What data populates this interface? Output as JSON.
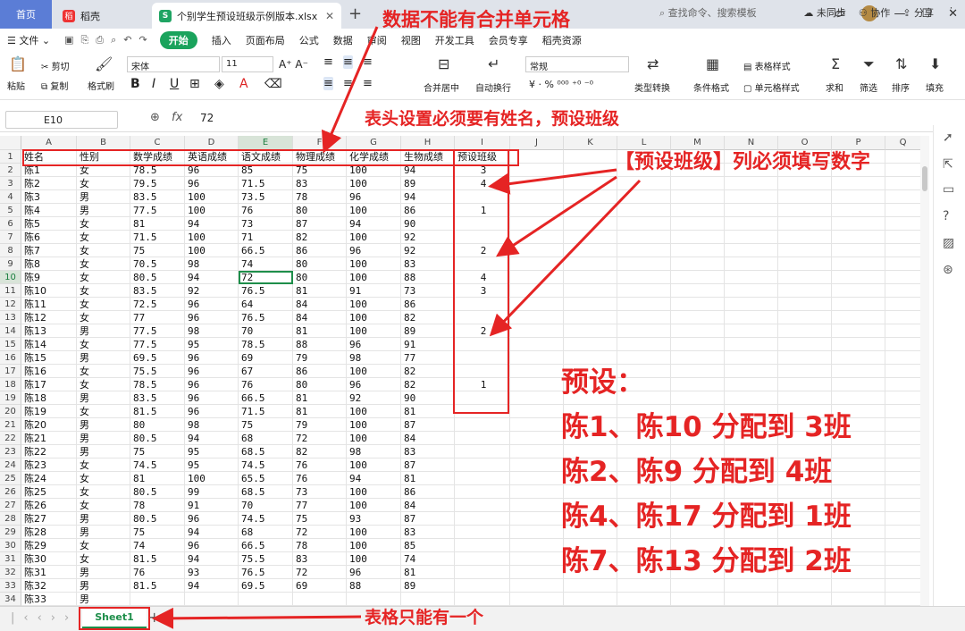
{
  "tabs": {
    "home": "首页",
    "docer": "稻壳",
    "file": "个别学生预设班级示例版本.xlsx"
  },
  "menu": {
    "file": "文件",
    "start": "开始",
    "items": [
      "插入",
      "页面布局",
      "公式",
      "数据",
      "审阅",
      "视图",
      "开发工具",
      "会员专享",
      "稻壳资源"
    ],
    "search": "查找命令、搜索模板",
    "right": [
      "未同步",
      "协作",
      "分享"
    ]
  },
  "ribbon": {
    "paste": "粘贴",
    "cut": "剪切",
    "copy": "复制",
    "format_painter": "格式刷",
    "font": "宋体",
    "size": "11",
    "num_format": "常规",
    "merge": "合并居中",
    "wrap": "自动换行",
    "convert": "类型转换",
    "cond_format": "条件格式",
    "table_style": "表格样式",
    "cell_style": "单元格样式",
    "sum": "求和",
    "filter": "筛选",
    "sort": "排序",
    "fill": "填充"
  },
  "formula_bar": {
    "cell_ref": "E10",
    "fx": "fx",
    "value": "72"
  },
  "columns": [
    "A",
    "B",
    "C",
    "D",
    "E",
    "F",
    "G",
    "H",
    "I",
    "J",
    "K",
    "L",
    "M",
    "N",
    "O",
    "P",
    "Q"
  ],
  "headers": [
    "姓名",
    "性别",
    "数学成绩",
    "英语成绩",
    "语文成绩",
    "物理成绩",
    "化学成绩",
    "生物成绩",
    "预设班级"
  ],
  "rows": [
    [
      "陈1",
      "女",
      "78.5",
      "96",
      "85",
      "75",
      "100",
      "94",
      "3"
    ],
    [
      "陈2",
      "女",
      "79.5",
      "96",
      "71.5",
      "83",
      "100",
      "89",
      "4"
    ],
    [
      "陈3",
      "男",
      "83.5",
      "100",
      "73.5",
      "78",
      "96",
      "94",
      ""
    ],
    [
      "陈4",
      "男",
      "77.5",
      "100",
      "76",
      "80",
      "100",
      "86",
      "1"
    ],
    [
      "陈5",
      "女",
      "81",
      "94",
      "73",
      "87",
      "94",
      "90",
      ""
    ],
    [
      "陈6",
      "女",
      "71.5",
      "100",
      "71",
      "82",
      "100",
      "92",
      ""
    ],
    [
      "陈7",
      "女",
      "75",
      "100",
      "66.5",
      "86",
      "96",
      "92",
      "2"
    ],
    [
      "陈8",
      "女",
      "70.5",
      "98",
      "74",
      "80",
      "100",
      "83",
      ""
    ],
    [
      "陈9",
      "女",
      "80.5",
      "94",
      "72",
      "80",
      "100",
      "88",
      "4"
    ],
    [
      "陈10",
      "女",
      "83.5",
      "92",
      "76.5",
      "81",
      "91",
      "73",
      "3"
    ],
    [
      "陈11",
      "女",
      "72.5",
      "96",
      "64",
      "84",
      "100",
      "86",
      ""
    ],
    [
      "陈12",
      "女",
      "77",
      "96",
      "76.5",
      "84",
      "100",
      "82",
      ""
    ],
    [
      "陈13",
      "男",
      "77.5",
      "98",
      "70",
      "81",
      "100",
      "89",
      "2"
    ],
    [
      "陈14",
      "女",
      "77.5",
      "95",
      "78.5",
      "88",
      "96",
      "91",
      ""
    ],
    [
      "陈15",
      "男",
      "69.5",
      "96",
      "69",
      "79",
      "98",
      "77",
      ""
    ],
    [
      "陈16",
      "女",
      "75.5",
      "96",
      "67",
      "86",
      "100",
      "82",
      ""
    ],
    [
      "陈17",
      "女",
      "78.5",
      "96",
      "76",
      "80",
      "96",
      "82",
      "1"
    ],
    [
      "陈18",
      "男",
      "83.5",
      "96",
      "66.5",
      "81",
      "92",
      "90",
      ""
    ],
    [
      "陈19",
      "女",
      "81.5",
      "96",
      "71.5",
      "81",
      "100",
      "81",
      ""
    ],
    [
      "陈20",
      "男",
      "80",
      "98",
      "75",
      "79",
      "100",
      "87",
      ""
    ],
    [
      "陈21",
      "男",
      "80.5",
      "94",
      "68",
      "72",
      "100",
      "84",
      ""
    ],
    [
      "陈22",
      "男",
      "75",
      "95",
      "68.5",
      "82",
      "98",
      "83",
      ""
    ],
    [
      "陈23",
      "女",
      "74.5",
      "95",
      "74.5",
      "76",
      "100",
      "87",
      ""
    ],
    [
      "陈24",
      "女",
      "81",
      "100",
      "65.5",
      "76",
      "94",
      "81",
      ""
    ],
    [
      "陈25",
      "女",
      "80.5",
      "99",
      "68.5",
      "73",
      "100",
      "86",
      ""
    ],
    [
      "陈26",
      "女",
      "78",
      "91",
      "70",
      "77",
      "100",
      "84",
      ""
    ],
    [
      "陈27",
      "男",
      "80.5",
      "96",
      "74.5",
      "75",
      "93",
      "87",
      ""
    ],
    [
      "陈28",
      "男",
      "75",
      "94",
      "68",
      "72",
      "100",
      "83",
      ""
    ],
    [
      "陈29",
      "女",
      "74",
      "96",
      "66.5",
      "78",
      "100",
      "85",
      ""
    ],
    [
      "陈30",
      "女",
      "81.5",
      "94",
      "75.5",
      "83",
      "100",
      "74",
      ""
    ],
    [
      "陈31",
      "男",
      "76",
      "93",
      "76.5",
      "72",
      "96",
      "81",
      ""
    ],
    [
      "陈32",
      "男",
      "81.5",
      "94",
      "69.5",
      "69",
      "88",
      "89",
      ""
    ],
    [
      "陈33",
      "男",
      "",
      "",
      "",
      "",
      "",
      "",
      ""
    ]
  ],
  "sheet_tab": "Sheet1",
  "annotations": {
    "no_merge": "数据不能有合并单元格",
    "header_rule": "表头设置必须要有姓名，预设班级",
    "fill_number": "【预设班级】列必须填写数字",
    "preset_title": "预设：",
    "preset_lines": [
      "陈1、陈10 分配到 3班",
      "陈2、陈9 分配到 4班",
      "陈4、陈17 分配到 1班",
      "陈7、陈13 分配到 2班"
    ],
    "one_sheet": "表格只能有一个"
  },
  "colors": {
    "accent": "#1aa35c",
    "annotation": "#e52424",
    "home_tab": "#5b7dd6"
  }
}
